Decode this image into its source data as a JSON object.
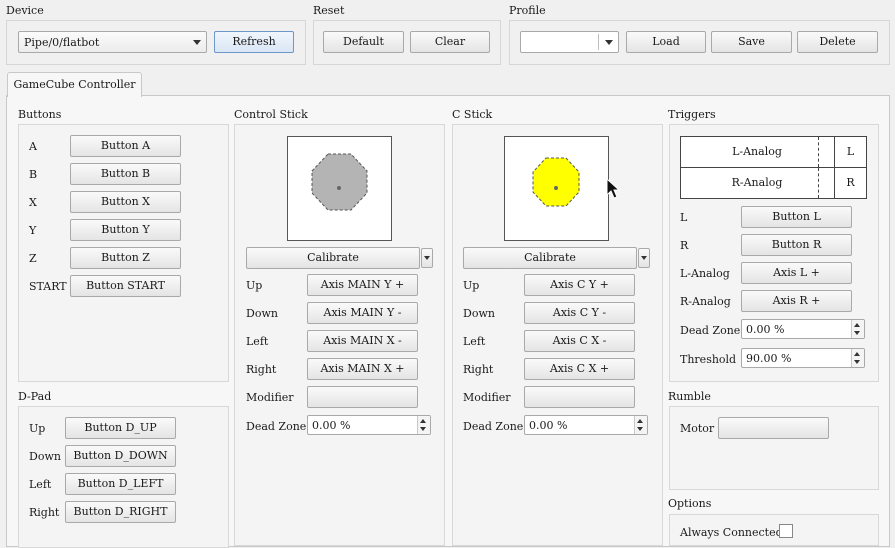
{
  "top": {
    "device": {
      "title": "Device",
      "selected": "Pipe/0/flatbot",
      "refresh_label": "Refresh"
    },
    "reset": {
      "title": "Reset",
      "default_label": "Default",
      "clear_label": "Clear"
    },
    "profile": {
      "title": "Profile",
      "selected": "",
      "load_label": "Load",
      "save_label": "Save",
      "delete_label": "Delete"
    }
  },
  "tab": {
    "label": "GameCube Controller"
  },
  "buttons": {
    "title": "Buttons",
    "rows": [
      {
        "label": "A",
        "value": "Button A"
      },
      {
        "label": "B",
        "value": "Button B"
      },
      {
        "label": "X",
        "value": "Button X"
      },
      {
        "label": "Y",
        "value": "Button Y"
      },
      {
        "label": "Z",
        "value": "Button Z"
      },
      {
        "label": "START",
        "value": "Button START"
      }
    ]
  },
  "dpad": {
    "title": "D-Pad",
    "rows": [
      {
        "label": "Up",
        "value": "Button D_UP"
      },
      {
        "label": "Down",
        "value": "Button D_DOWN"
      },
      {
        "label": "Left",
        "value": "Button D_LEFT"
      },
      {
        "label": "Right",
        "value": "Button D_RIGHT"
      }
    ]
  },
  "control_stick": {
    "title": "Control Stick",
    "calibrate_label": "Calibrate",
    "octagon_color": "#b4b4b4",
    "rows": [
      {
        "label": "Up",
        "value": "Axis MAIN Y +"
      },
      {
        "label": "Down",
        "value": "Axis MAIN Y -"
      },
      {
        "label": "Left",
        "value": "Axis MAIN X -"
      },
      {
        "label": "Right",
        "value": "Axis MAIN X +"
      },
      {
        "label": "Modifier",
        "value": ""
      }
    ],
    "dead_zone_label": "Dead Zone",
    "dead_zone_value": "0.00 %"
  },
  "c_stick": {
    "title": "C Stick",
    "calibrate_label": "Calibrate",
    "octagon_color": "#ffff00",
    "rows": [
      {
        "label": "Up",
        "value": "Axis C Y +"
      },
      {
        "label": "Down",
        "value": "Axis C Y -"
      },
      {
        "label": "Left",
        "value": "Axis C X -"
      },
      {
        "label": "Right",
        "value": "Axis C X +"
      },
      {
        "label": "Modifier",
        "value": ""
      }
    ],
    "dead_zone_label": "Dead Zone",
    "dead_zone_value": "0.00 %"
  },
  "triggers": {
    "title": "Triggers",
    "bars": [
      {
        "name": "L-Analog",
        "key": "L"
      },
      {
        "name": "R-Analog",
        "key": "R"
      }
    ],
    "rows": [
      {
        "label": "L",
        "value": "Button L"
      },
      {
        "label": "R",
        "value": "Button R"
      },
      {
        "label": "L-Analog",
        "value": "Axis L +"
      },
      {
        "label": "R-Analog",
        "value": "Axis R +"
      }
    ],
    "dead_zone_label": "Dead Zone",
    "dead_zone_value": "0.00 %",
    "threshold_label": "Threshold",
    "threshold_value": "90.00 %"
  },
  "rumble": {
    "title": "Rumble",
    "motor_label": "Motor",
    "motor_value": ""
  },
  "options": {
    "title": "Options",
    "always_connected_label": "Always Connected",
    "always_connected_checked": false
  }
}
